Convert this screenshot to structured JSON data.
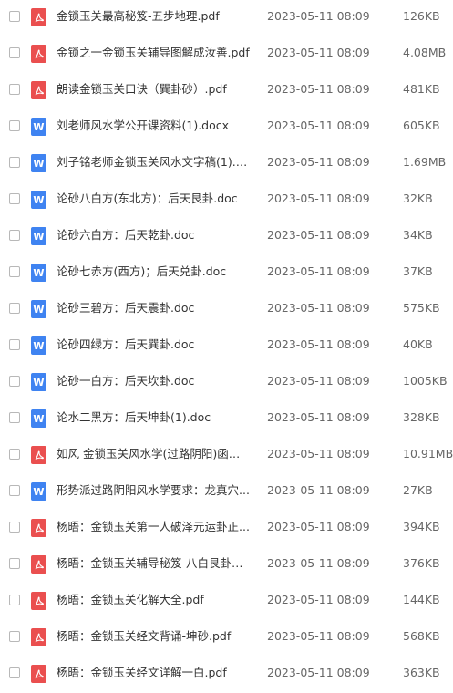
{
  "colors": {
    "pdf_icon": "#ea4f4f",
    "doc_icon": "#3f83f1",
    "text": "#333333",
    "meta_text": "#666666"
  },
  "icons": {
    "pdf": "pdf-file-icon",
    "doc": "word-file-icon",
    "doc_glyph": "W"
  },
  "files": [
    {
      "name": "金锁玉关最高秘笈-五步地理.pdf",
      "type": "pdf",
      "date": "2023-05-11 08:09",
      "size": "126KB"
    },
    {
      "name": "金锁之一金锁玉关辅导图解成汝善.pdf",
      "type": "pdf",
      "date": "2023-05-11 08:09",
      "size": "4.08MB"
    },
    {
      "name": "朗读金锁玉关口诀（巽卦砂）.pdf",
      "type": "pdf",
      "date": "2023-05-11 08:09",
      "size": "481KB"
    },
    {
      "name": "刘老师风水学公开课资料(1).docx",
      "type": "doc",
      "date": "2023-05-11 08:09",
      "size": "605KB"
    },
    {
      "name": "刘子铭老师金锁玉关风水文字稿(1).doc...",
      "type": "doc",
      "date": "2023-05-11 08:09",
      "size": "1.69MB"
    },
    {
      "name": "论砂八白方(东北方)：后天艮卦.doc",
      "type": "doc",
      "date": "2023-05-11 08:09",
      "size": "32KB"
    },
    {
      "name": "论砂六白方：后天乾卦.doc",
      "type": "doc",
      "date": "2023-05-11 08:09",
      "size": "34KB"
    },
    {
      "name": "论砂七赤方(西方)；后天兑卦.doc",
      "type": "doc",
      "date": "2023-05-11 08:09",
      "size": "37KB"
    },
    {
      "name": "论砂三碧方：后天震卦.doc",
      "type": "doc",
      "date": "2023-05-11 08:09",
      "size": "575KB"
    },
    {
      "name": "论砂四绿方：后天巽卦.doc",
      "type": "doc",
      "date": "2023-05-11 08:09",
      "size": "40KB"
    },
    {
      "name": "论砂一白方：后天坎卦.doc",
      "type": "doc",
      "date": "2023-05-11 08:09",
      "size": "1005KB"
    },
    {
      "name": "论水二黑方：后天坤卦(1).doc",
      "type": "doc",
      "date": "2023-05-11 08:09",
      "size": "328KB"
    },
    {
      "name": "如风 金锁玉关风水学(过路阴阳)函授...",
      "type": "pdf",
      "date": "2023-05-11 08:09",
      "size": "10.91MB"
    },
    {
      "name": "形势派过路阴阳风水学要求：龙真穴...",
      "type": "doc",
      "date": "2023-05-11 08:09",
      "size": "27KB"
    },
    {
      "name": "杨晤：金锁玉关第一人破泽元运卦正...",
      "type": "pdf",
      "date": "2023-05-11 08:09",
      "size": "394KB"
    },
    {
      "name": "杨晤：金锁玉关辅导秘笈-八白艮卦水....",
      "type": "pdf",
      "date": "2023-05-11 08:09",
      "size": "376KB"
    },
    {
      "name": "杨晤：金锁玉关化解大全.pdf",
      "type": "pdf",
      "date": "2023-05-11 08:09",
      "size": "144KB"
    },
    {
      "name": "杨晤：金锁玉关经文背诵-坤砂.pdf",
      "type": "pdf",
      "date": "2023-05-11 08:09",
      "size": "568KB"
    },
    {
      "name": "杨晤：金锁玉关经文详解一白.pdf",
      "type": "pdf",
      "date": "2023-05-11 08:09",
      "size": "363KB"
    }
  ]
}
